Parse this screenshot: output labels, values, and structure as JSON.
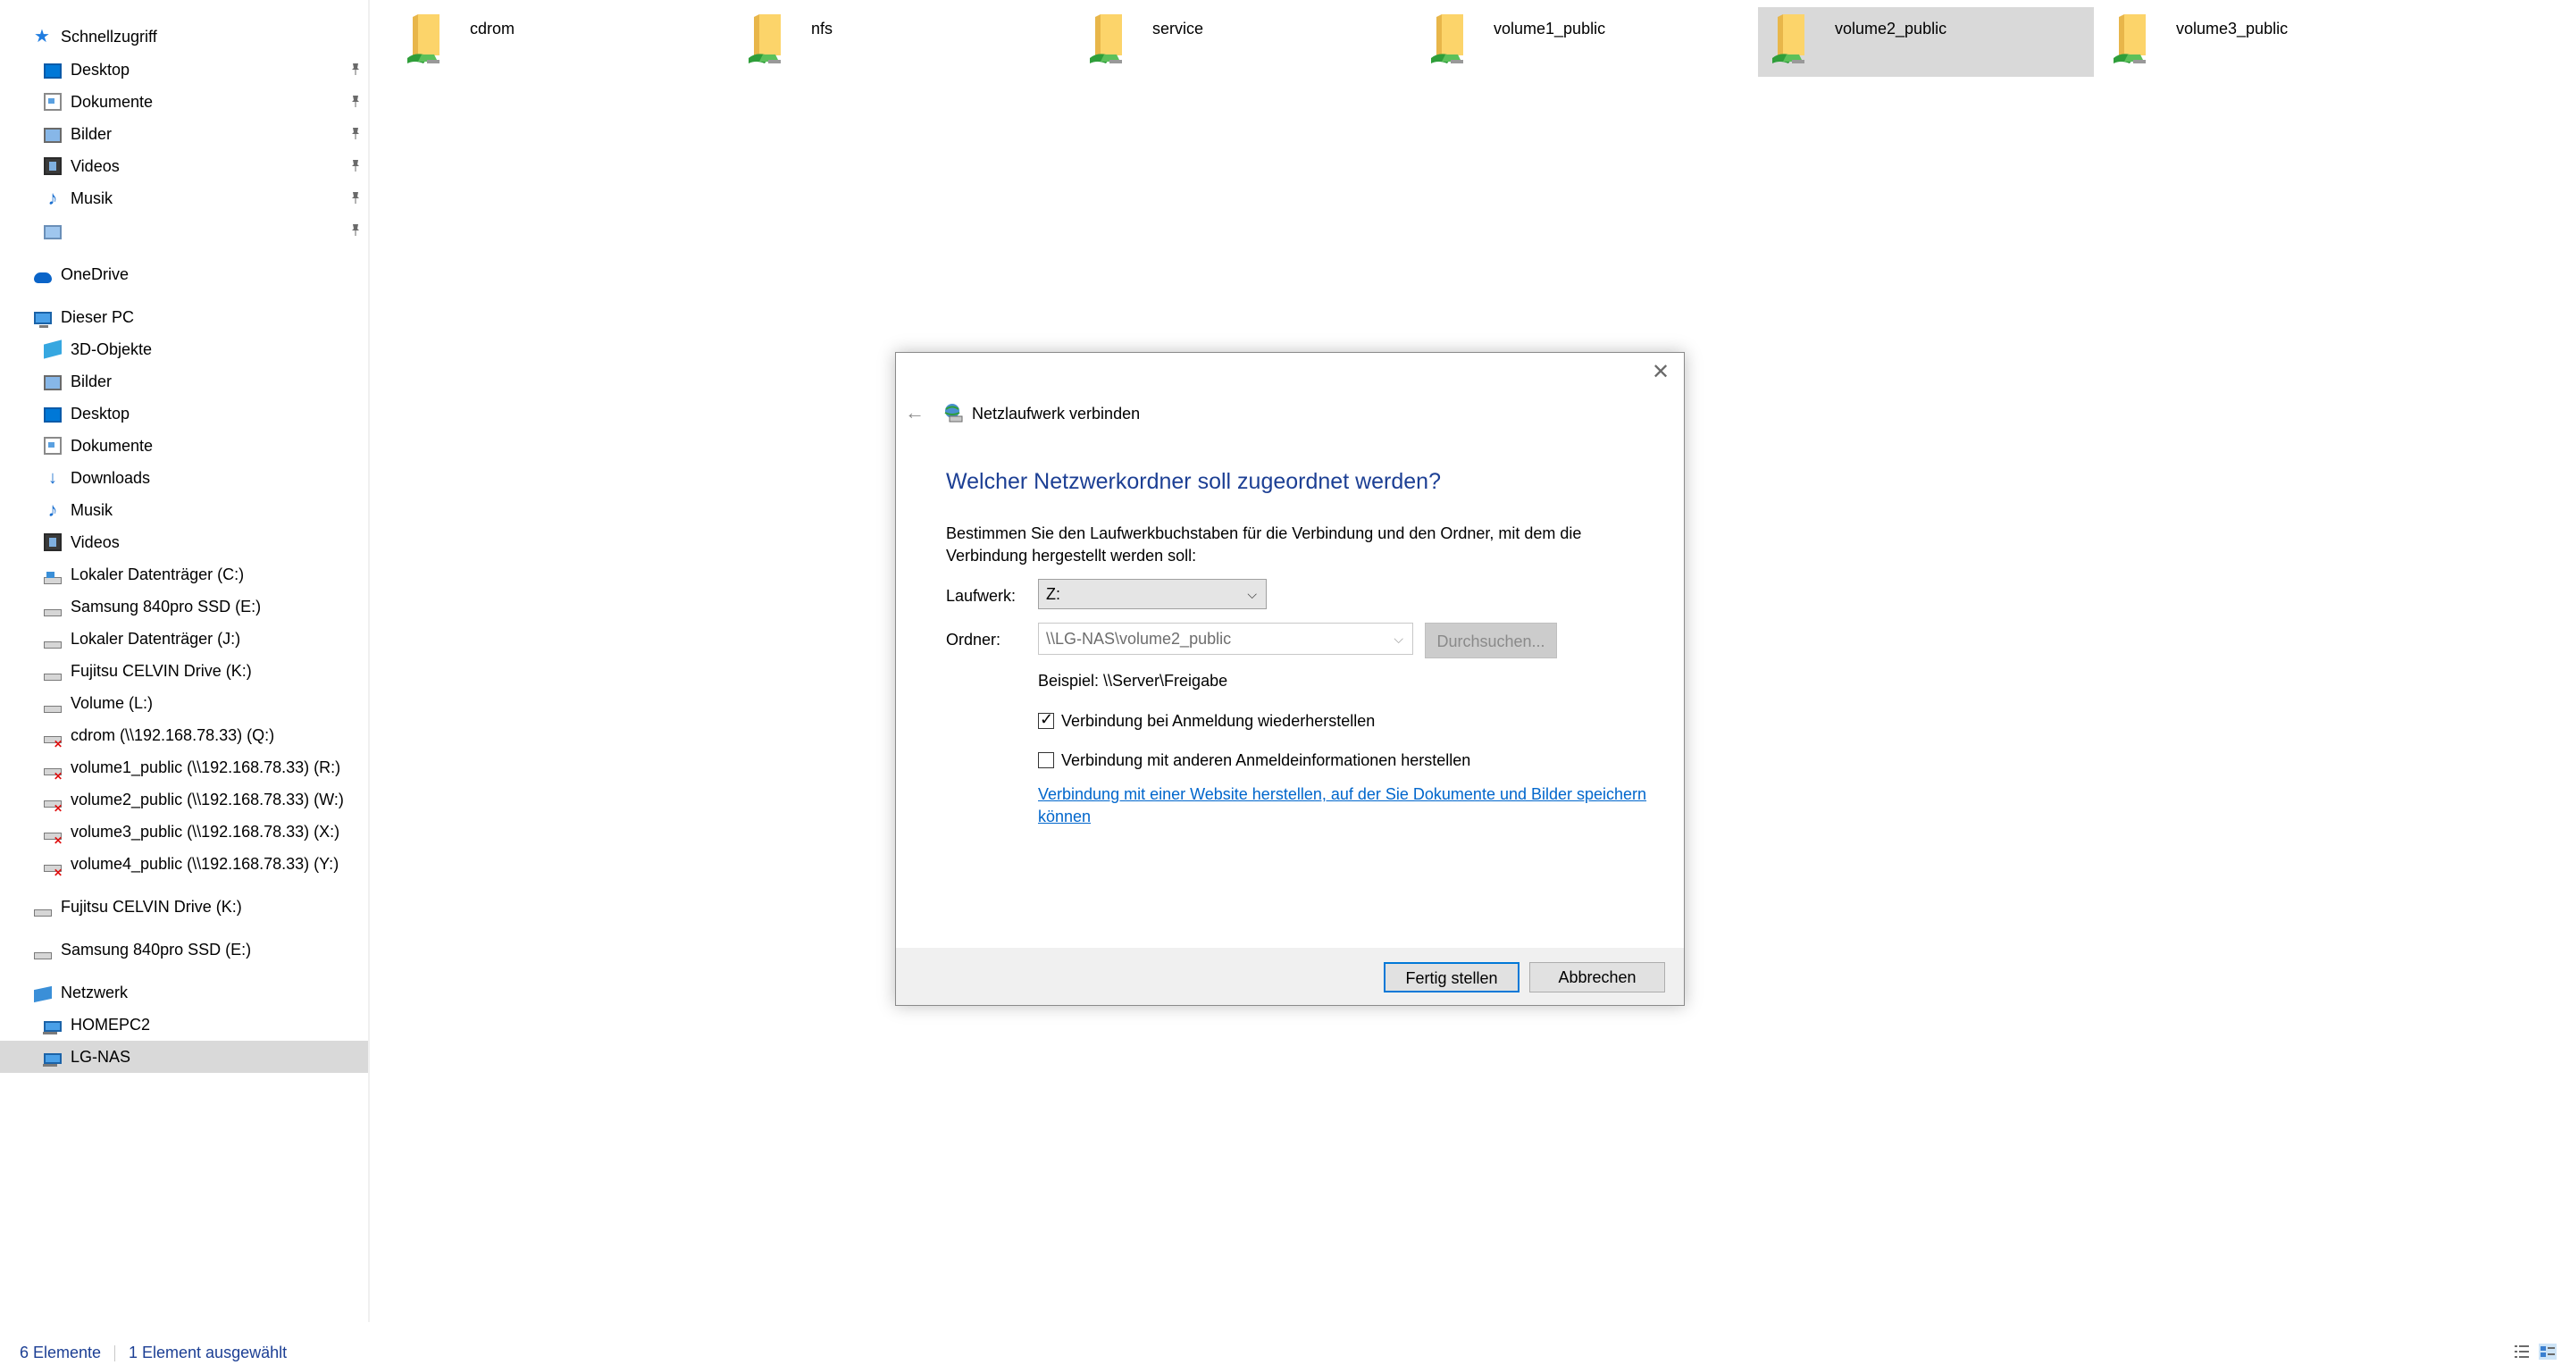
{
  "sidebar": {
    "quick_access": {
      "label": "Schnellzugriff",
      "items": [
        {
          "label": "Desktop"
        },
        {
          "label": "Dokumente"
        },
        {
          "label": "Bilder"
        },
        {
          "label": "Videos"
        },
        {
          "label": "Musik"
        },
        {
          "label": ""
        }
      ]
    },
    "onedrive": {
      "label": "OneDrive"
    },
    "this_pc": {
      "label": "Dieser PC",
      "items": [
        {
          "label": "3D-Objekte"
        },
        {
          "label": "Bilder"
        },
        {
          "label": "Desktop"
        },
        {
          "label": "Dokumente"
        },
        {
          "label": "Downloads"
        },
        {
          "label": "Musik"
        },
        {
          "label": "Videos"
        },
        {
          "label": "Lokaler Datenträger (C:)"
        },
        {
          "label": "Samsung 840pro SSD (E:)"
        },
        {
          "label": "Lokaler Datenträger (J:)"
        },
        {
          "label": "Fujitsu CELVIN Drive (K:)"
        },
        {
          "label": "Volume (L:)"
        },
        {
          "label": "cdrom (\\\\192.168.78.33) (Q:)"
        },
        {
          "label": "volume1_public (\\\\192.168.78.33) (R:)"
        },
        {
          "label": "volume2_public (\\\\192.168.78.33) (W:)"
        },
        {
          "label": "volume3_public (\\\\192.168.78.33) (X:)"
        },
        {
          "label": "volume4_public (\\\\192.168.78.33) (Y:)"
        }
      ]
    },
    "fujitsu": {
      "label": "Fujitsu CELVIN Drive (K:)"
    },
    "samsung": {
      "label": "Samsung 840pro SSD (E:)"
    },
    "network": {
      "label": "Netzwerk",
      "items": [
        {
          "label": "HOMEPC2"
        },
        {
          "label": "LG-NAS"
        }
      ]
    }
  },
  "folders": [
    {
      "name": "cdrom"
    },
    {
      "name": "nfs"
    },
    {
      "name": "service"
    },
    {
      "name": "volume1_public"
    },
    {
      "name": "volume2_public"
    },
    {
      "name": "volume3_public"
    }
  ],
  "dialog": {
    "title": "Netzlaufwerk verbinden",
    "heading": "Welcher Netzwerkordner soll zugeordnet werden?",
    "description": "Bestimmen Sie den Laufwerkbuchstaben für die Verbindung und den Ordner, mit dem die Verbindung hergestellt werden soll:",
    "drive_label": "Laufwerk:",
    "drive_value": "Z:",
    "folder_label": "Ordner:",
    "folder_value": "\\\\LG-NAS\\volume2_public",
    "browse_label": "Durchsuchen...",
    "example": "Beispiel: \\\\Server\\Freigabe",
    "reconnect_label": "Verbindung bei Anmeldung wiederherstellen",
    "reconnect_checked": true,
    "other_credentials_label": "Verbindung mit anderen Anmeldeinformationen herstellen",
    "other_credentials_checked": false,
    "website_link": "Verbindung mit einer Website herstellen, auf der Sie Dokumente und Bilder speichern können",
    "finish_label": "Fertig stellen",
    "cancel_label": "Abbrechen"
  },
  "status": {
    "count": "6 Elemente",
    "selected": "1 Element ausgewählt"
  },
  "colors": {
    "heading": "#1c3f94",
    "link": "#0066cc",
    "selection": "#d9d9d9",
    "accent": "#0078d7"
  }
}
